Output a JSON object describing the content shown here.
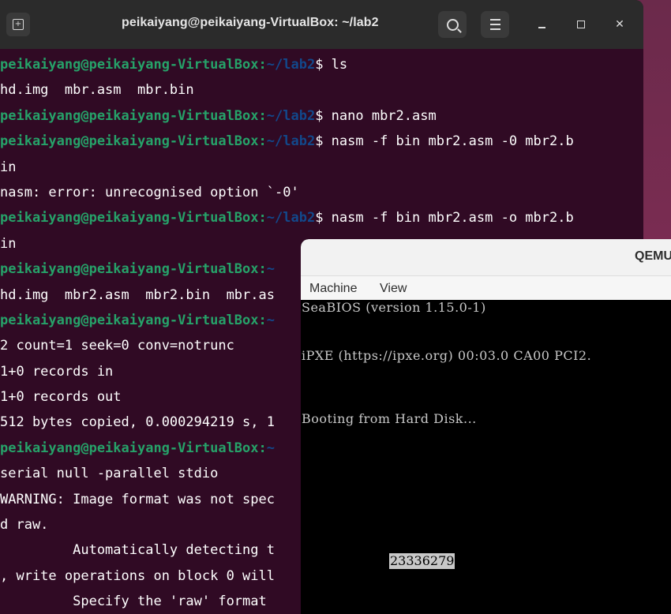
{
  "terminal": {
    "title": "peikaiyang@peikaiyang-VirtualBox: ~/lab2",
    "icons": {
      "new_tab": "new-tab-icon",
      "search": "search-icon",
      "menu": "hamburger-menu-icon"
    },
    "lines": [
      {
        "user": "peikaiyang@peikaiyang-VirtualBox",
        "sep": ":",
        "path": "~/lab2",
        "rest": "$ ls"
      },
      {
        "text": "hd.img  mbr.asm  mbr.bin"
      },
      {
        "user": "peikaiyang@peikaiyang-VirtualBox",
        "sep": ":",
        "path": "~/lab2",
        "rest": "$ nano mbr2.asm"
      },
      {
        "user": "peikaiyang@peikaiyang-VirtualBox",
        "sep": ":",
        "path": "~/lab2",
        "rest": "$ nasm -f bin mbr2.asm -0 mbr2.b"
      },
      {
        "text": "in"
      },
      {
        "text": "nasm: error: unrecognised option `-0'"
      },
      {
        "user": "peikaiyang@peikaiyang-VirtualBox",
        "sep": ":",
        "path": "~/lab2",
        "rest": "$ nasm -f bin mbr2.asm -o mbr2.b"
      },
      {
        "text": "in"
      },
      {
        "user": "peikaiyang@peikaiyang-VirtualBox",
        "sep": ":",
        "path": "~",
        "rest": ""
      },
      {
        "text": "hd.img  mbr2.asm  mbr2.bin  mbr.as"
      },
      {
        "user": "peikaiyang@peikaiyang-VirtualBox",
        "sep": ":",
        "path": "~",
        "rest": ""
      },
      {
        "text": "2 count=1 seek=0 conv=notrunc"
      },
      {
        "text": "1+0 records in"
      },
      {
        "text": "1+0 records out"
      },
      {
        "text": "512 bytes copied, 0.000294219 s, 1"
      },
      {
        "user": "peikaiyang@peikaiyang-VirtualBox",
        "sep": ":",
        "path": "~",
        "rest": ""
      },
      {
        "text": "serial null -parallel stdio"
      },
      {
        "text": "WARNING: Image format was not spec"
      },
      {
        "text": "d raw."
      },
      {
        "text": "         Automatically detecting t"
      },
      {
        "text": ", write operations on block 0 will"
      },
      {
        "text": "         Specify the 'raw' format "
      }
    ],
    "colors": {
      "background": "#300a24",
      "user": "#26a269",
      "path": "#12488b",
      "text": "#ffffff"
    }
  },
  "qemu": {
    "title": "QEMU",
    "menu": [
      "Machine",
      "View"
    ],
    "screen_lines": [
      "SeaBIOS (version 1.15.0-1)",
      "iPXE (https://ipxe.org) 00:03.0 CA00 PCI2.",
      "Booting from Hard Disk..."
    ],
    "highlight": "23336279"
  }
}
